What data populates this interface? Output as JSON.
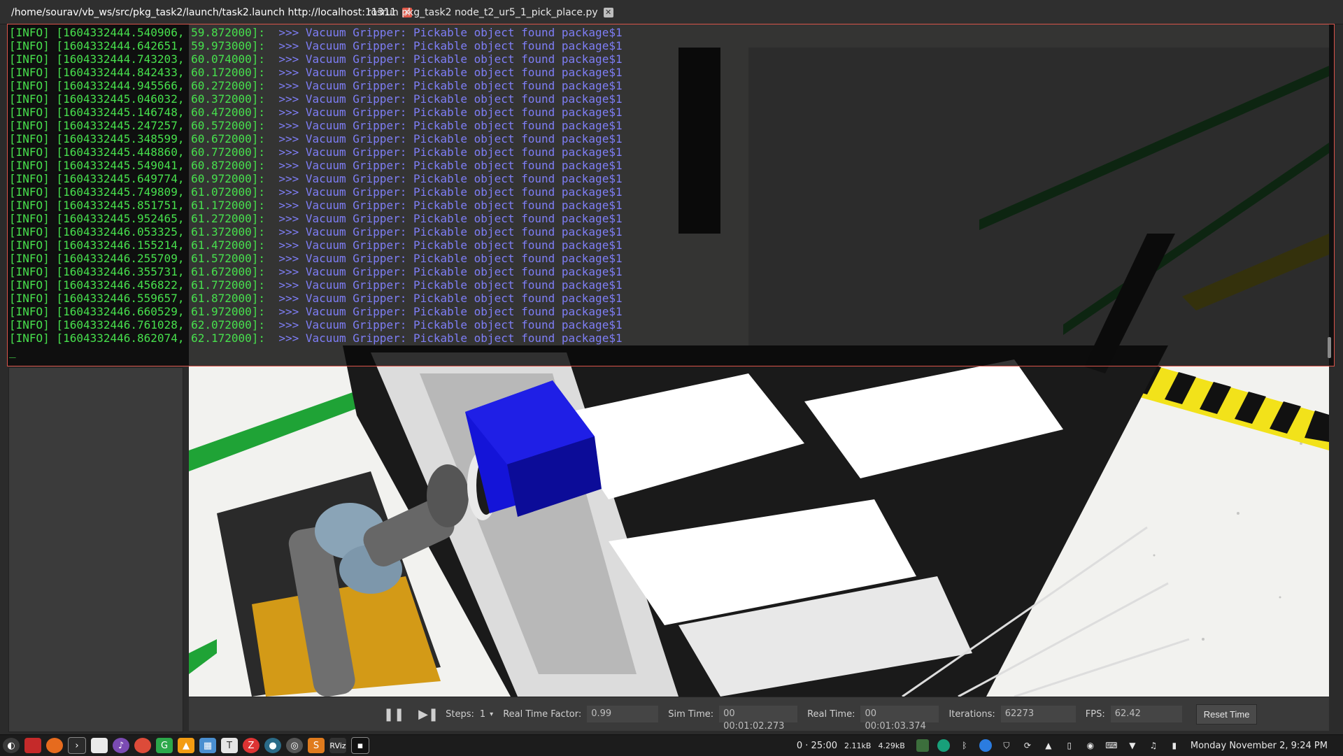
{
  "tabs": [
    {
      "title": "/home/sourav/vb_ws/src/pkg_task2/launch/task2.launch http://localhost:11311",
      "active": true
    },
    {
      "title": "rosrun pkg_task2 node_t2_ur5_1_pick_place.py",
      "active": false
    }
  ],
  "terminal": {
    "lines": [
      {
        "prefix": "[INFO] [1604332444.540906, 59.872000]:",
        "msg": ">>> Vacuum Gripper: Pickable object found package$1"
      },
      {
        "prefix": "[INFO] [1604332444.642651, 59.973000]:",
        "msg": ">>> Vacuum Gripper: Pickable object found package$1"
      },
      {
        "prefix": "[INFO] [1604332444.743203, 60.074000]:",
        "msg": ">>> Vacuum Gripper: Pickable object found package$1"
      },
      {
        "prefix": "[INFO] [1604332444.842433, 60.172000]:",
        "msg": ">>> Vacuum Gripper: Pickable object found package$1"
      },
      {
        "prefix": "[INFO] [1604332444.945566, 60.272000]:",
        "msg": ">>> Vacuum Gripper: Pickable object found package$1"
      },
      {
        "prefix": "[INFO] [1604332445.046032, 60.372000]:",
        "msg": ">>> Vacuum Gripper: Pickable object found package$1"
      },
      {
        "prefix": "[INFO] [1604332445.146748, 60.472000]:",
        "msg": ">>> Vacuum Gripper: Pickable object found package$1"
      },
      {
        "prefix": "[INFO] [1604332445.247257, 60.572000]:",
        "msg": ">>> Vacuum Gripper: Pickable object found package$1"
      },
      {
        "prefix": "[INFO] [1604332445.348599, 60.672000]:",
        "msg": ">>> Vacuum Gripper: Pickable object found package$1"
      },
      {
        "prefix": "[INFO] [1604332445.448860, 60.772000]:",
        "msg": ">>> Vacuum Gripper: Pickable object found package$1"
      },
      {
        "prefix": "[INFO] [1604332445.549041, 60.872000]:",
        "msg": ">>> Vacuum Gripper: Pickable object found package$1"
      },
      {
        "prefix": "[INFO] [1604332445.649774, 60.972000]:",
        "msg": ">>> Vacuum Gripper: Pickable object found package$1"
      },
      {
        "prefix": "[INFO] [1604332445.749809, 61.072000]:",
        "msg": ">>> Vacuum Gripper: Pickable object found package$1"
      },
      {
        "prefix": "[INFO] [1604332445.851751, 61.172000]:",
        "msg": ">>> Vacuum Gripper: Pickable object found package$1"
      },
      {
        "prefix": "[INFO] [1604332445.952465, 61.272000]:",
        "msg": ">>> Vacuum Gripper: Pickable object found package$1"
      },
      {
        "prefix": "[INFO] [1604332446.053325, 61.372000]:",
        "msg": ">>> Vacuum Gripper: Pickable object found package$1"
      },
      {
        "prefix": "[INFO] [1604332446.155214, 61.472000]:",
        "msg": ">>> Vacuum Gripper: Pickable object found package$1"
      },
      {
        "prefix": "[INFO] [1604332446.255709, 61.572000]:",
        "msg": ">>> Vacuum Gripper: Pickable object found package$1"
      },
      {
        "prefix": "[INFO] [1604332446.355731, 61.672000]:",
        "msg": ">>> Vacuum Gripper: Pickable object found package$1"
      },
      {
        "prefix": "[INFO] [1604332446.456822, 61.772000]:",
        "msg": ">>> Vacuum Gripper: Pickable object found package$1"
      },
      {
        "prefix": "[INFO] [1604332446.559657, 61.872000]:",
        "msg": ">>> Vacuum Gripper: Pickable object found package$1"
      },
      {
        "prefix": "[INFO] [1604332446.660529, 61.972000]:",
        "msg": ">>> Vacuum Gripper: Pickable object found package$1"
      },
      {
        "prefix": "[INFO] [1604332446.761028, 62.072000]:",
        "msg": ">>> Vacuum Gripper: Pickable object found package$1"
      },
      {
        "prefix": "[INFO] [1604332446.862074, 62.172000]:",
        "msg": ">>> Vacuum Gripper: Pickable object found package$1"
      }
    ],
    "cursor": "_"
  },
  "gazebo_toolbar": {
    "steps_label": "Steps:",
    "steps_value": "1",
    "rtf_label": "Real Time Factor:",
    "rtf_value": "0.99",
    "sim_time_label": "Sim Time:",
    "sim_time_value": "00 00:01:02.273",
    "real_time_label": "Real Time:",
    "real_time_value": "00 00:01:03.374",
    "iterations_label": "Iterations:",
    "iterations_value": "62273",
    "fps_label": "FPS:",
    "fps_value": "62.42",
    "reset_label": "Reset Time"
  },
  "taskbar": {
    "timer": "0 · 25:00",
    "net_down": "2.11kB",
    "net_up": "4.29kB",
    "clock": "Monday November  2, 9:24 PM",
    "rviz_label": "RViz"
  },
  "colors": {
    "log_prefix": "#47e04d",
    "log_message": "#7e7ef6",
    "terminal_border": "#d9544a",
    "package_box": "#1414d8"
  }
}
